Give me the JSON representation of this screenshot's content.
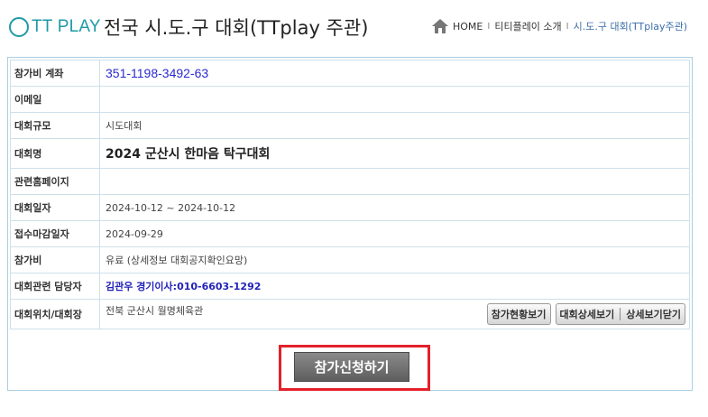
{
  "header": {
    "logo_text": "TT PLAY",
    "title": "전국 시.도.구 대회(TTplay 주관)",
    "breadcrumb": [
      {
        "label": "HOME"
      },
      {
        "label": "티티플레이 소개"
      },
      {
        "label": "시.도.구 대회(TTplay주관)"
      }
    ],
    "separator": "I"
  },
  "fields": {
    "account": {
      "label": "참가비 계좌",
      "value": "351-1198-3492-63"
    },
    "email": {
      "label": "이메일",
      "value": ""
    },
    "scale": {
      "label": "대회규모",
      "value": "시도대회"
    },
    "name": {
      "label": "대회명",
      "value": "2024 군산시 한마음 탁구대회"
    },
    "homepage": {
      "label": "관련홈페이지",
      "value": ""
    },
    "date": {
      "label": "대회일자",
      "value": "2024-10-12 ~ 2024-10-12"
    },
    "deadline": {
      "label": "접수마감일자",
      "value": "2024-09-29"
    },
    "fee": {
      "label": "참가비",
      "value": "유료 (상세정보 대회공지확인요망)"
    },
    "contact": {
      "label": "대회관련 담당자",
      "value": "김관우 경기이사:010-6603-1292"
    },
    "venue": {
      "label": "대회위치/대회장",
      "value": "전북 군산시 월명체육관"
    }
  },
  "buttons": {
    "participants": "참가현황보기",
    "detail": "대회상세보기",
    "close_detail": "상세보기닫기",
    "apply": "참가신청하기"
  },
  "colors": {
    "brand": "#1f9aa6",
    "highlight_border": "#e3202a",
    "account_text": "#2a2ad0"
  }
}
